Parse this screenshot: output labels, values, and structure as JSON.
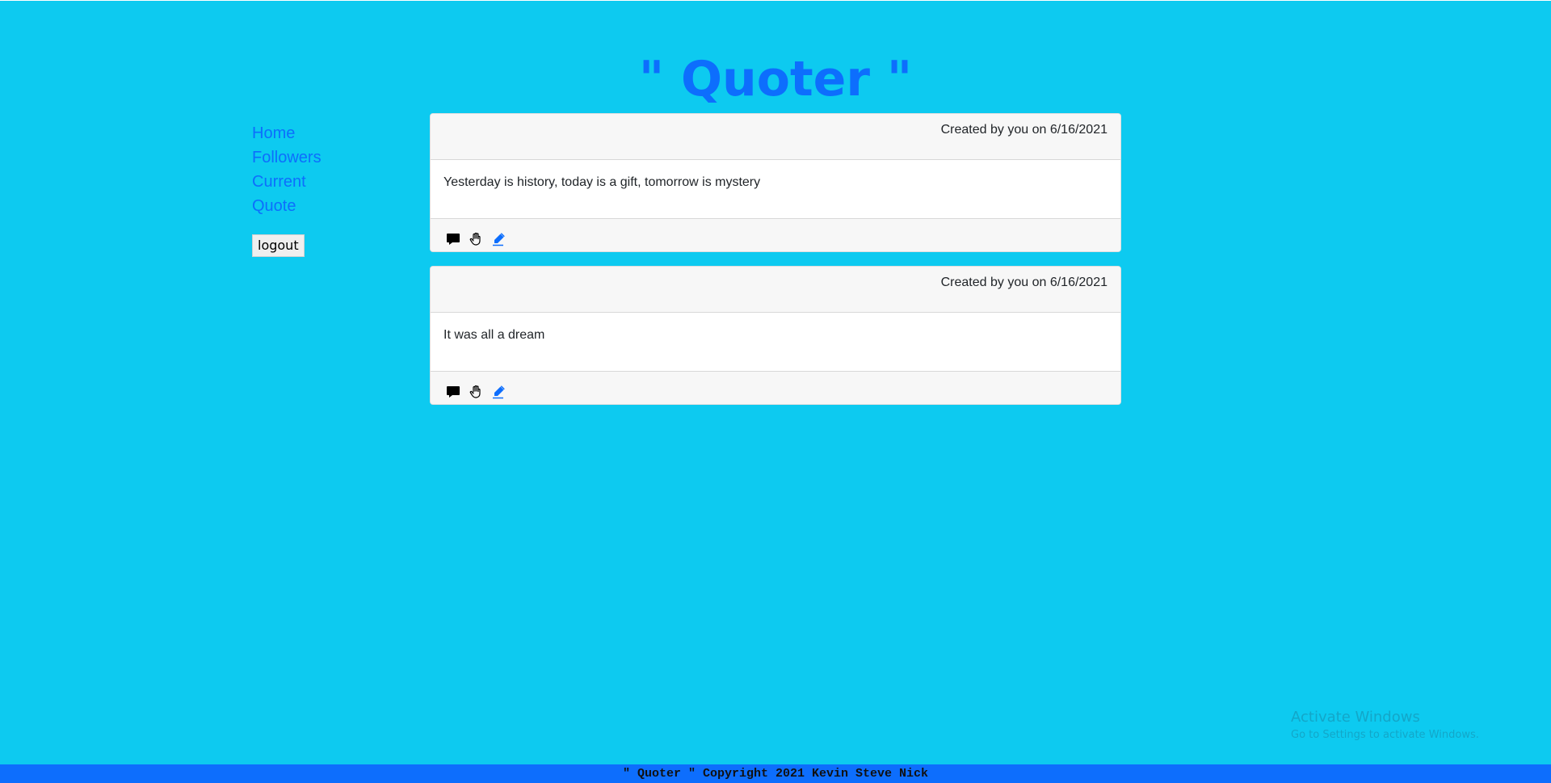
{
  "header": {
    "title": "\" Quoter \""
  },
  "sidebar": {
    "links": [
      {
        "label": "Home"
      },
      {
        "label": "Followers"
      },
      {
        "label": "Current"
      },
      {
        "label": "Quote"
      }
    ],
    "logout_label": "logout"
  },
  "quotes": [
    {
      "meta": "Created by you on 6/16/2021",
      "text": "Yesterday is history, today is a gift, tomorrow is mystery",
      "actions": [
        "comment-icon",
        "hand-icon",
        "edit-pen-icon"
      ]
    },
    {
      "meta": "Created by you on 6/16/2021",
      "text": "It was all a dream",
      "actions": [
        "comment-icon",
        "hand-icon",
        "edit-pen-icon"
      ]
    }
  ],
  "watermark": {
    "title": "Activate Windows",
    "subtitle": "Go to Settings to activate Windows."
  },
  "footer": {
    "text": "\" Quoter \" Copyright 2021 Kevin Steve Nick"
  },
  "colors": {
    "background": "#0dcaf0",
    "accent": "#0d6efd",
    "card_header": "#f7f7f7"
  }
}
